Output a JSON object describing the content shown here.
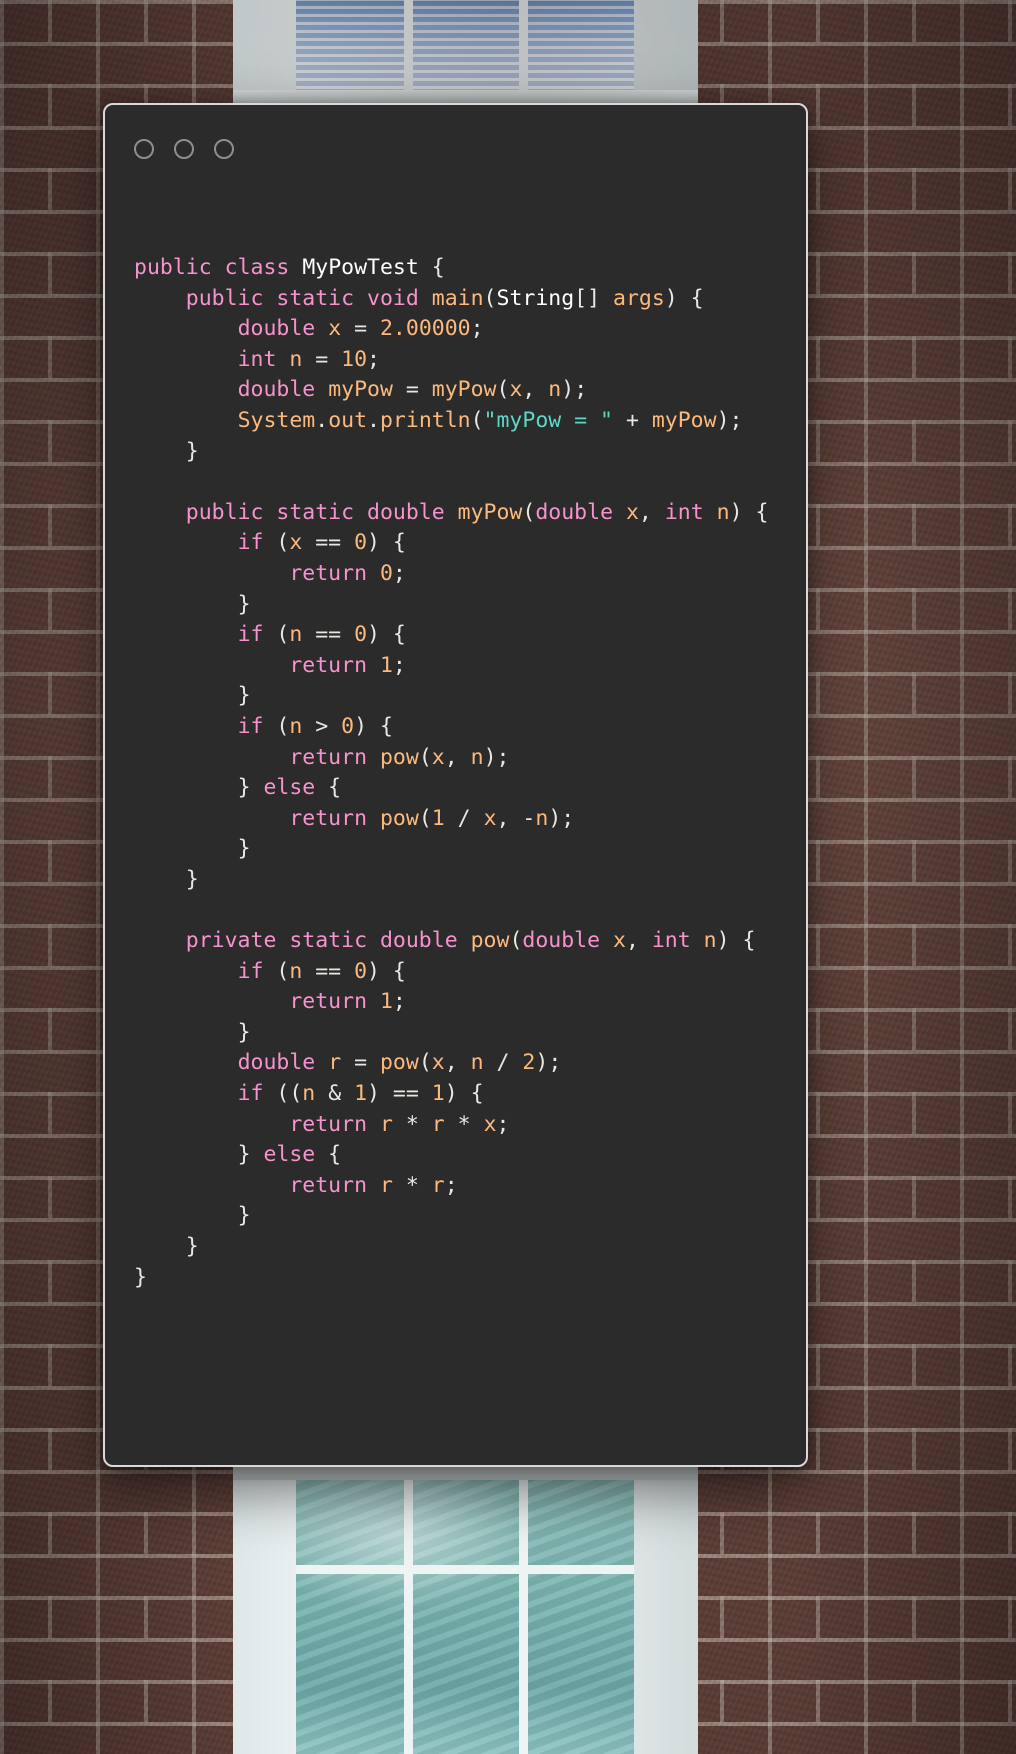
{
  "window": {
    "title_dots": [
      "traffic-light-1",
      "traffic-light-2",
      "traffic-light-3"
    ],
    "background_color": "#2b2b2b",
    "border_color": "#d9d9d9"
  },
  "theme": {
    "keyword": "#f692ce",
    "identifier": "#fcb97d",
    "string": "#5fd7c8",
    "plain": "#e8e8e3",
    "class_name": "#ffffff",
    "background": "#2b2b2b"
  },
  "code": {
    "language": "java",
    "class_name": "MyPowTest",
    "plain_text": "public class MyPowTest {\n    public static void main(String[] args) {\n        double x = 2.00000;\n        int n = 10;\n        double myPow = myPow(x, n);\n        System.out.println(\"myPow = \" + myPow);\n    }\n\n    public static double myPow(double x, int n) {\n        if (x == 0) {\n            return 0;\n        }\n        if (n == 0) {\n            return 1;\n        }\n        if (n > 0) {\n            return pow(x, n);\n        } else {\n            return pow(1 / x, -n);\n        }\n    }\n\n    private static double pow(double x, int n) {\n        if (n == 0) {\n            return 1;\n        }\n        double r = pow(x, n / 2);\n        if ((n & 1) == 1) {\n            return r * r * x;\n        } else {\n            return r * r;\n        }\n    }\n}",
    "lines": [
      [
        [
          "k",
          "public"
        ],
        [
          "pl",
          " "
        ],
        [
          "k",
          "class"
        ],
        [
          "pl",
          " "
        ],
        [
          "cls",
          "MyPowTest"
        ],
        [
          "pl",
          " {"
        ]
      ],
      [
        [
          "pl",
          "    "
        ],
        [
          "k",
          "public"
        ],
        [
          "pl",
          " "
        ],
        [
          "k",
          "static"
        ],
        [
          "pl",
          " "
        ],
        [
          "k",
          "void"
        ],
        [
          "pl",
          " "
        ],
        [
          "id",
          "main"
        ],
        [
          "pl",
          "("
        ],
        [
          "cls",
          "String"
        ],
        [
          "pl",
          "[] "
        ],
        [
          "id",
          "args"
        ],
        [
          "pl",
          ") {"
        ]
      ],
      [
        [
          "pl",
          "        "
        ],
        [
          "k",
          "double"
        ],
        [
          "pl",
          " "
        ],
        [
          "id",
          "x"
        ],
        [
          "pl",
          " = "
        ],
        [
          "num",
          "2.00000"
        ],
        [
          "pl",
          ";"
        ]
      ],
      [
        [
          "pl",
          "        "
        ],
        [
          "k",
          "int"
        ],
        [
          "pl",
          " "
        ],
        [
          "id",
          "n"
        ],
        [
          "pl",
          " = "
        ],
        [
          "num",
          "10"
        ],
        [
          "pl",
          ";"
        ]
      ],
      [
        [
          "pl",
          "        "
        ],
        [
          "k",
          "double"
        ],
        [
          "pl",
          " "
        ],
        [
          "id",
          "myPow"
        ],
        [
          "pl",
          " = "
        ],
        [
          "id",
          "myPow"
        ],
        [
          "pl",
          "("
        ],
        [
          "id",
          "x"
        ],
        [
          "pl",
          ", "
        ],
        [
          "id",
          "n"
        ],
        [
          "pl",
          ");"
        ]
      ],
      [
        [
          "pl",
          "        "
        ],
        [
          "id",
          "System"
        ],
        [
          "pl",
          "."
        ],
        [
          "id",
          "out"
        ],
        [
          "pl",
          "."
        ],
        [
          "id",
          "println"
        ],
        [
          "pl",
          "("
        ],
        [
          "str",
          "\"myPow = \""
        ],
        [
          "pl",
          " + "
        ],
        [
          "id",
          "myPow"
        ],
        [
          "pl",
          ");"
        ]
      ],
      [
        [
          "pl",
          "    }"
        ]
      ],
      [
        [
          "pl",
          ""
        ]
      ],
      [
        [
          "pl",
          "    "
        ],
        [
          "k",
          "public"
        ],
        [
          "pl",
          " "
        ],
        [
          "k",
          "static"
        ],
        [
          "pl",
          " "
        ],
        [
          "k",
          "double"
        ],
        [
          "pl",
          " "
        ],
        [
          "id",
          "myPow"
        ],
        [
          "pl",
          "("
        ],
        [
          "k",
          "double"
        ],
        [
          "pl",
          " "
        ],
        [
          "id",
          "x"
        ],
        [
          "pl",
          ", "
        ],
        [
          "k",
          "int"
        ],
        [
          "pl",
          " "
        ],
        [
          "id",
          "n"
        ],
        [
          "pl",
          ") {"
        ]
      ],
      [
        [
          "pl",
          "        "
        ],
        [
          "k",
          "if"
        ],
        [
          "pl",
          " ("
        ],
        [
          "id",
          "x"
        ],
        [
          "pl",
          " == "
        ],
        [
          "num",
          "0"
        ],
        [
          "pl",
          ") {"
        ]
      ],
      [
        [
          "pl",
          "            "
        ],
        [
          "k",
          "return"
        ],
        [
          "pl",
          " "
        ],
        [
          "num",
          "0"
        ],
        [
          "pl",
          ";"
        ]
      ],
      [
        [
          "pl",
          "        }"
        ]
      ],
      [
        [
          "pl",
          "        "
        ],
        [
          "k",
          "if"
        ],
        [
          "pl",
          " ("
        ],
        [
          "id",
          "n"
        ],
        [
          "pl",
          " == "
        ],
        [
          "num",
          "0"
        ],
        [
          "pl",
          ") {"
        ]
      ],
      [
        [
          "pl",
          "            "
        ],
        [
          "k",
          "return"
        ],
        [
          "pl",
          " "
        ],
        [
          "num",
          "1"
        ],
        [
          "pl",
          ";"
        ]
      ],
      [
        [
          "pl",
          "        }"
        ]
      ],
      [
        [
          "pl",
          "        "
        ],
        [
          "k",
          "if"
        ],
        [
          "pl",
          " ("
        ],
        [
          "id",
          "n"
        ],
        [
          "pl",
          " > "
        ],
        [
          "num",
          "0"
        ],
        [
          "pl",
          ") {"
        ]
      ],
      [
        [
          "pl",
          "            "
        ],
        [
          "k",
          "return"
        ],
        [
          "pl",
          " "
        ],
        [
          "id",
          "pow"
        ],
        [
          "pl",
          "("
        ],
        [
          "id",
          "x"
        ],
        [
          "pl",
          ", "
        ],
        [
          "id",
          "n"
        ],
        [
          "pl",
          ");"
        ]
      ],
      [
        [
          "pl",
          "        } "
        ],
        [
          "k",
          "else"
        ],
        [
          "pl",
          " {"
        ]
      ],
      [
        [
          "pl",
          "            "
        ],
        [
          "k",
          "return"
        ],
        [
          "pl",
          " "
        ],
        [
          "id",
          "pow"
        ],
        [
          "pl",
          "("
        ],
        [
          "num",
          "1"
        ],
        [
          "pl",
          " / "
        ],
        [
          "id",
          "x"
        ],
        [
          "pl",
          ", -"
        ],
        [
          "id",
          "n"
        ],
        [
          "pl",
          ");"
        ]
      ],
      [
        [
          "pl",
          "        }"
        ]
      ],
      [
        [
          "pl",
          "    }"
        ]
      ],
      [
        [
          "pl",
          ""
        ]
      ],
      [
        [
          "pl",
          "    "
        ],
        [
          "k",
          "private"
        ],
        [
          "pl",
          " "
        ],
        [
          "k",
          "static"
        ],
        [
          "pl",
          " "
        ],
        [
          "k",
          "double"
        ],
        [
          "pl",
          " "
        ],
        [
          "id",
          "pow"
        ],
        [
          "pl",
          "("
        ],
        [
          "k",
          "double"
        ],
        [
          "pl",
          " "
        ],
        [
          "id",
          "x"
        ],
        [
          "pl",
          ", "
        ],
        [
          "k",
          "int"
        ],
        [
          "pl",
          " "
        ],
        [
          "id",
          "n"
        ],
        [
          "pl",
          ") {"
        ]
      ],
      [
        [
          "pl",
          "        "
        ],
        [
          "k",
          "if"
        ],
        [
          "pl",
          " ("
        ],
        [
          "id",
          "n"
        ],
        [
          "pl",
          " == "
        ],
        [
          "num",
          "0"
        ],
        [
          "pl",
          ") {"
        ]
      ],
      [
        [
          "pl",
          "            "
        ],
        [
          "k",
          "return"
        ],
        [
          "pl",
          " "
        ],
        [
          "num",
          "1"
        ],
        [
          "pl",
          ";"
        ]
      ],
      [
        [
          "pl",
          "        }"
        ]
      ],
      [
        [
          "pl",
          "        "
        ],
        [
          "k",
          "double"
        ],
        [
          "pl",
          " "
        ],
        [
          "id",
          "r"
        ],
        [
          "pl",
          " = "
        ],
        [
          "id",
          "pow"
        ],
        [
          "pl",
          "("
        ],
        [
          "id",
          "x"
        ],
        [
          "pl",
          ", "
        ],
        [
          "id",
          "n"
        ],
        [
          "pl",
          " / "
        ],
        [
          "num",
          "2"
        ],
        [
          "pl",
          ");"
        ]
      ],
      [
        [
          "pl",
          "        "
        ],
        [
          "k",
          "if"
        ],
        [
          "pl",
          " (("
        ],
        [
          "id",
          "n"
        ],
        [
          "pl",
          " & "
        ],
        [
          "num",
          "1"
        ],
        [
          "pl",
          ") == "
        ],
        [
          "num",
          "1"
        ],
        [
          "pl",
          ") {"
        ]
      ],
      [
        [
          "pl",
          "            "
        ],
        [
          "k",
          "return"
        ],
        [
          "pl",
          " "
        ],
        [
          "id",
          "r"
        ],
        [
          "pl",
          " * "
        ],
        [
          "id",
          "r"
        ],
        [
          "pl",
          " * "
        ],
        [
          "id",
          "x"
        ],
        [
          "pl",
          ";"
        ]
      ],
      [
        [
          "pl",
          "        } "
        ],
        [
          "k",
          "else"
        ],
        [
          "pl",
          " {"
        ]
      ],
      [
        [
          "pl",
          "            "
        ],
        [
          "k",
          "return"
        ],
        [
          "pl",
          " "
        ],
        [
          "id",
          "r"
        ],
        [
          "pl",
          " * "
        ],
        [
          "id",
          "r"
        ],
        [
          "pl",
          ";"
        ]
      ],
      [
        [
          "pl",
          "        }"
        ]
      ],
      [
        [
          "pl",
          "    }"
        ]
      ],
      [
        [
          "pl",
          "}"
        ]
      ]
    ]
  }
}
